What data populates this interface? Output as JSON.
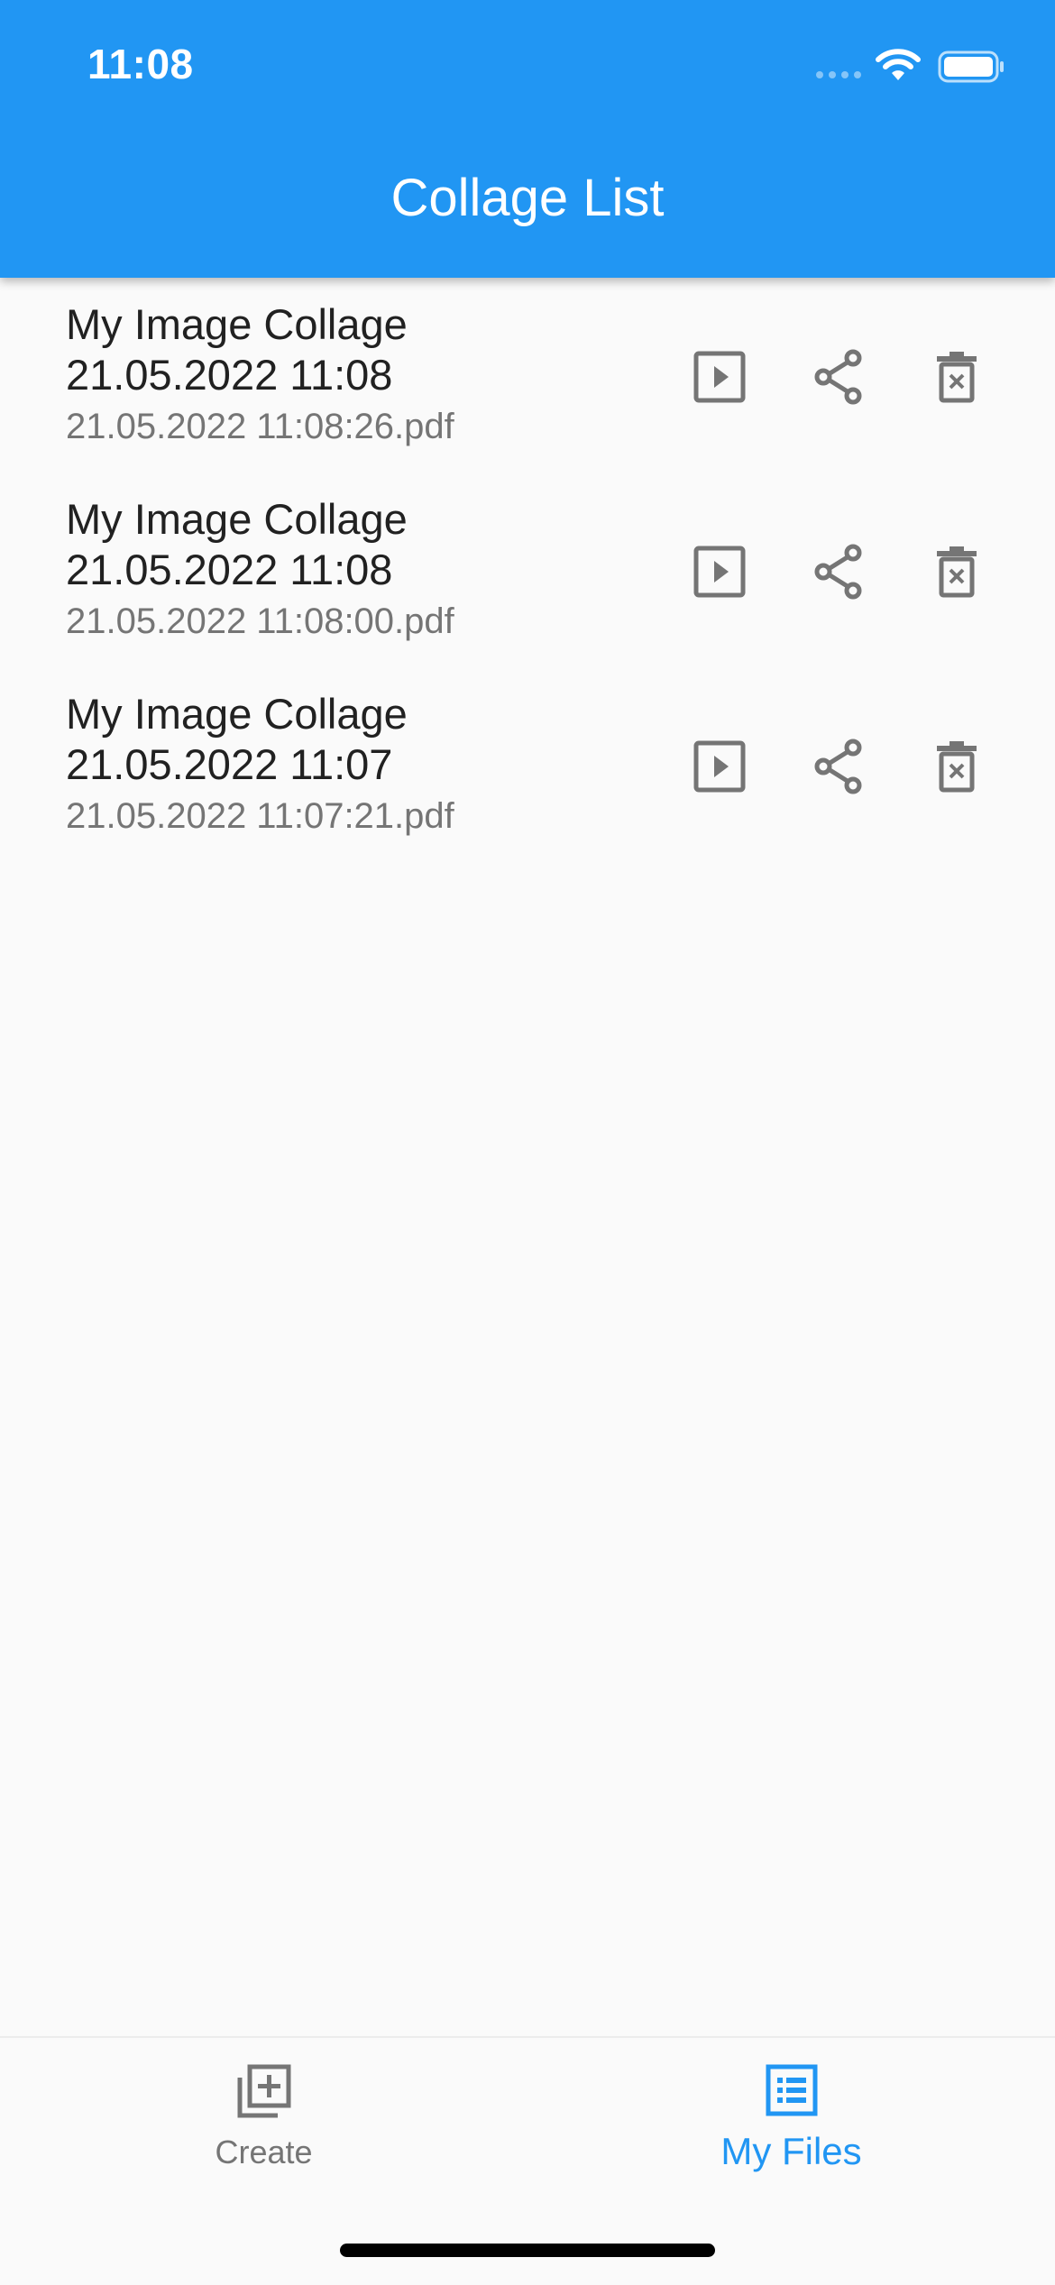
{
  "status_bar": {
    "time": "11:08"
  },
  "app_bar": {
    "title": "Collage List"
  },
  "files": [
    {
      "title": "My Image Collage 21.05.2022 11:08",
      "filename": "21.05.2022 11:08:26.pdf"
    },
    {
      "title": "My Image Collage 21.05.2022 11:08",
      "filename": "21.05.2022 11:08:00.pdf"
    },
    {
      "title": "My Image Collage 21.05.2022 11:07",
      "filename": "21.05.2022 11:07:21.pdf"
    }
  ],
  "row_icons": [
    "play-icon",
    "share-icon",
    "delete-icon"
  ],
  "bottom_nav": {
    "items": [
      {
        "label": "Create",
        "icon": "add-collection-icon",
        "active": false
      },
      {
        "label": "My Files",
        "icon": "list-icon",
        "active": true
      }
    ]
  },
  "colors": {
    "primary": "#2196f3",
    "icon_gray": "#757575",
    "text": "#212121",
    "background": "#fafafa"
  }
}
